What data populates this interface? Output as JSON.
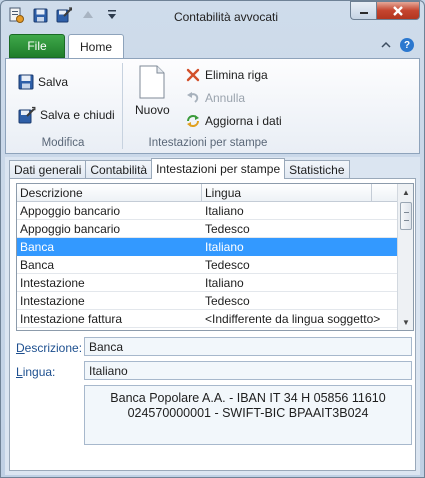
{
  "window": {
    "title": "Contabilità avvocati"
  },
  "ribbon": {
    "tabs": {
      "file": "File",
      "home": "Home"
    },
    "modifica": {
      "save": "Salva",
      "save_close": "Salva e chiudi",
      "label": "Modifica"
    },
    "intestazioni": {
      "new": "Nuovo",
      "delete_row": "Elimina riga",
      "cancel": "Annulla",
      "refresh": "Aggiorna i dati",
      "label": "Intestazioni per stampe"
    }
  },
  "content_tabs": [
    "Dati generali",
    "Contabilità",
    "Intestazioni per stampe",
    "Statistiche"
  ],
  "table": {
    "headers": [
      "Descrizione",
      "Lingua"
    ],
    "rows": [
      [
        "Appoggio bancario",
        "Italiano"
      ],
      [
        "Appoggio bancario",
        "Tedesco"
      ],
      [
        "Banca",
        "Italiano"
      ],
      [
        "Banca",
        "Tedesco"
      ],
      [
        "Intestazione",
        "Italiano"
      ],
      [
        "Intestazione",
        "Tedesco"
      ],
      [
        "Intestazione fattura",
        "<Indifferente da lingua soggetto>"
      ]
    ],
    "selected_row": 2
  },
  "form": {
    "descrizione_label_first": "D",
    "descrizione_label_rest": "escrizione:",
    "descrizione_value": "Banca",
    "lingua_label_first": "L",
    "lingua_label_rest": "ingua:",
    "lingua_value": "Italiano",
    "text": "Banca Popolare A.A.  - IBAN IT 34 H 05856 11610\n024570000001  - SWIFT-BIC BPAAIT3B024"
  },
  "colors": {
    "selection": "#3399ff",
    "file_tab": "#2a8c36",
    "close_button": "#c5452f"
  }
}
